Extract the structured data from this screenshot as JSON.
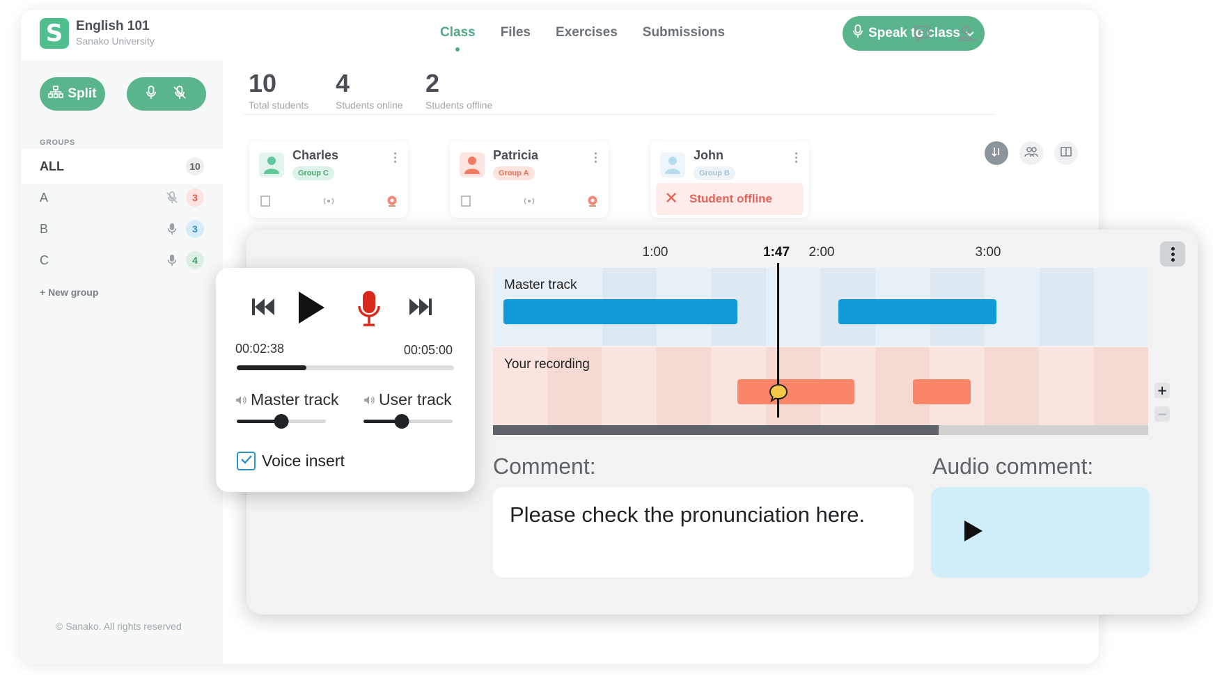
{
  "app": {
    "logo_letter": "S",
    "course_title": "English 101",
    "course_subtitle": "Sanako University",
    "nav": [
      {
        "label": "Class",
        "active": true
      },
      {
        "label": "Files",
        "active": false
      },
      {
        "label": "Exercises",
        "active": false
      },
      {
        "label": "Submissions",
        "active": false
      }
    ],
    "speak_button": "Speak to class",
    "accent_color": "#5bb58c"
  },
  "sidebar": {
    "split_label": "Split",
    "groups_heading": "GROUPS",
    "groups": [
      {
        "name": "ALL",
        "count": "10",
        "mic": "none"
      },
      {
        "name": "A",
        "count": "3",
        "mic": "muted"
      },
      {
        "name": "B",
        "count": "3",
        "mic": "on"
      },
      {
        "name": "C",
        "count": "4",
        "mic": "on"
      }
    ],
    "new_group": "+ New group",
    "footer": "© Sanako. All rights reserved"
  },
  "stats": [
    {
      "value": "10",
      "label": "Total students"
    },
    {
      "value": "4",
      "label": "Students online"
    },
    {
      "value": "2",
      "label": "Students offline"
    }
  ],
  "students": [
    {
      "name": "Charles",
      "group": "Group C",
      "status": "online"
    },
    {
      "name": "Patricia",
      "group": "Group A",
      "status": "online"
    },
    {
      "name": "John",
      "group": "Group B",
      "status": "offline",
      "status_text": "Student offline"
    }
  ],
  "editor": {
    "time_markers": [
      "1:00",
      "1:47",
      "2:00",
      "3:00"
    ],
    "current_time_marker": "1:47",
    "master_track_label": "Master track",
    "user_track_label": "Your recording",
    "comment_label": "Comment:",
    "comment_text": "Please check the pronunciation here.",
    "audio_comment_label": "Audio comment:",
    "timeline_scroll_fraction": 0.68
  },
  "player": {
    "current_time": "00:02:38",
    "total_time": "00:05:00",
    "progress": 0.32,
    "master_volume_label": "Master track",
    "user_volume_label": "User track",
    "master_volume": 0.5,
    "user_volume": 0.43,
    "voice_insert_label": "Voice insert",
    "voice_insert_checked": true,
    "record_color": "#d9291c"
  }
}
